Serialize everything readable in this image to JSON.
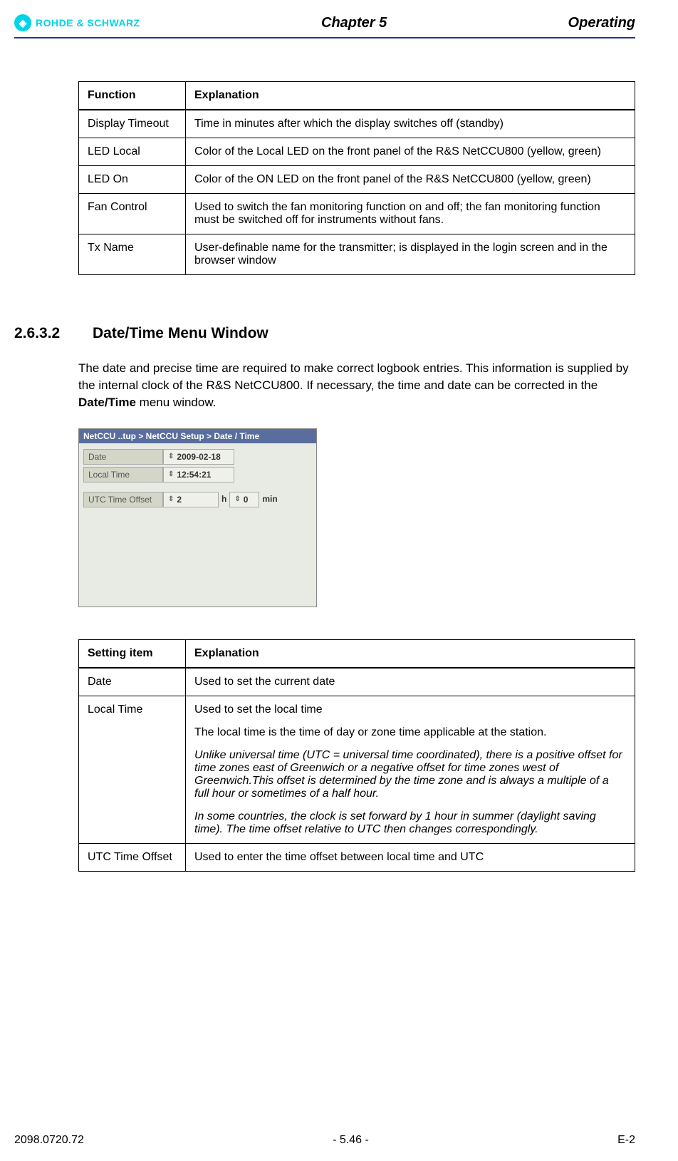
{
  "header": {
    "logo_text": "ROHDE & SCHWARZ",
    "center": "Chapter 5",
    "right": "Operating"
  },
  "table1": {
    "col1_header": "Function",
    "col2_header": "Explanation",
    "rows": [
      {
        "func": "Display Timeout",
        "exp": "Time in minutes after which the display switches off (standby)"
      },
      {
        "func": "LED Local",
        "exp": "Color of the Local LED on the front panel of the R&S NetCCU800 (yellow, green)"
      },
      {
        "func": "LED On",
        "exp": "Color of the ON LED on the front panel of the R&S NetCCU800 (yellow, green)"
      },
      {
        "func": "Fan Control",
        "exp": "Used to switch the fan monitoring function on and off; the fan monitoring function must be switched off for instruments without fans."
      },
      {
        "func": "Tx Name",
        "exp": "User-definable name for the transmitter; is displayed in the login screen and in the browser window"
      }
    ]
  },
  "section": {
    "number": "2.6.3.2",
    "title": "Date/Time Menu Window",
    "para_before": "The date and precise time are required to make correct logbook entries. This information is supplied by the internal clock of the R&S NetCCU800. If necessary, the time and date can be corrected in the ",
    "para_bold": "Date/Time",
    "para_after": " menu window."
  },
  "screenshot": {
    "titlebar": "NetCCU ..tup > NetCCU Setup > Date / Time",
    "date_label": "Date",
    "date_value": "2009-02-18",
    "localtime_label": "Local Time",
    "localtime_value": "12:54:21",
    "utc_label": "UTC Time Offset",
    "utc_h_value": "2",
    "utc_h_unit": "h",
    "utc_m_value": "0",
    "utc_m_unit": "min"
  },
  "table2": {
    "col1_header": "Setting item",
    "col2_header": "Explanation",
    "rows": [
      {
        "item": "Date",
        "exp_simple": "Used to set the current date"
      },
      {
        "item": "Local Time",
        "p1": "Used to set the local time",
        "p2": "The local time is the time of day or zone time applicable at the station.",
        "p3": "Unlike universal time (UTC = universal time coordinated), there is a positive offset for time zones east of Greenwich or a negative offset for time zones west of Greenwich.This offset is determined by the time zone and is always a multiple of a full hour or sometimes of a half hour.",
        "p4": "In some countries, the clock is set forward by 1 hour in summer (daylight saving time). The time offset relative to UTC then changes correspondingly."
      },
      {
        "item": "UTC Time Offset",
        "exp_simple": "Used to enter the time offset between local time and UTC"
      }
    ]
  },
  "footer": {
    "left": "2098.0720.72",
    "center": "- 5.46 -",
    "right": "E-2"
  }
}
